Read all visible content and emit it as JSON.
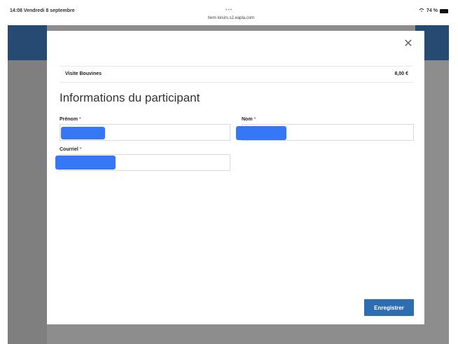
{
  "status_bar": {
    "time": "14:08 Vendredi 8 septembre",
    "url": "hem-loisirs.s2.eapla.com",
    "battery_text": "74 %",
    "dots": "•••"
  },
  "modal": {
    "summary": {
      "item_name": "Visite Bouvines",
      "price": "8,00 €"
    },
    "title": "Informations du participant",
    "fields": {
      "first_name": {
        "label": "Prénom",
        "required_mark": "*"
      },
      "last_name": {
        "label": "Nom",
        "required_mark": "*"
      },
      "email": {
        "label": "Courriel",
        "required_mark": "*"
      }
    },
    "save_label": "Enregistrer",
    "close_symbol": "✕"
  },
  "colors": {
    "modal_bg": "#ffffff",
    "backdrop": "#8d8d8d",
    "header_blue": "#274a72",
    "primary_button": "#2f6db3",
    "required": "#e26060",
    "redaction": "#2f73f5"
  }
}
